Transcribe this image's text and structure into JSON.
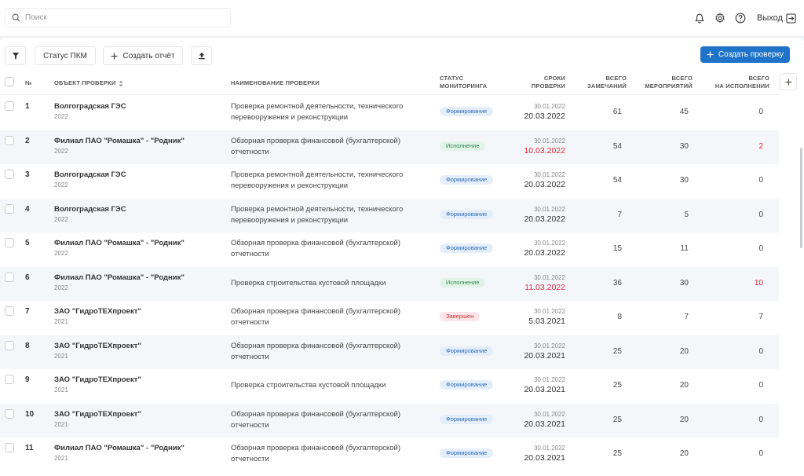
{
  "search": {
    "placeholder": "Поиск",
    "value": ""
  },
  "header": {
    "logout_label": "Выход"
  },
  "icons": {
    "search": "search-icon",
    "bell": "bell-icon",
    "settings": "gear-icon",
    "help": "help-icon",
    "logout": "logout-icon",
    "filter": "filter-icon",
    "upload": "upload-icon",
    "plus": "plus-icon",
    "sort": "sort-icon"
  },
  "colors": {
    "primary": "#1f73c9",
    "red": "#e0283a",
    "badge_form_bg": "#e4eefb",
    "badge_isp_bg": "#e2f4e8",
    "badge_zav_bg": "#fbe5e8"
  },
  "toolbar": {
    "status_pkm_label": "Статус ПКМ",
    "create_report_label": "Создать отчёт",
    "create_check_label": "Создать проверку"
  },
  "table": {
    "columns": {
      "num": "№",
      "object": "ОБЪЕКТ ПРОВЕРКИ",
      "name": "НАИМЕНОВАНИЕ ПРОВЕРКИ",
      "status_l1": "СТАТУС",
      "status_l2": "МОНИТОРИНГА",
      "dates_l1": "СРОКИ",
      "dates_l2": "ПРОВЕРКИ",
      "remarks_l1": "ВСЕГО",
      "remarks_l2": "ЗАМЕЧАНИЙ",
      "measures_l1": "ВСЕГО",
      "measures_l2": "МЕРОПРИЯТИЙ",
      "exec_l1": "ВСЕГО",
      "exec_l2": "НА ИСПОЛНЕНИИ"
    },
    "rows": [
      {
        "num": "1",
        "object": "Волгоградская ГЭС",
        "year": "2022",
        "name": "Проверка ремонтной деятельности, технического перевооружения и реконструкции",
        "status": "Формирование",
        "status_type": "form",
        "date_start": "30.01.2022",
        "date_end": "20.03.2022",
        "date_end_red": false,
        "remarks": "61",
        "measures": "45",
        "exec": "0",
        "exec_red": false
      },
      {
        "num": "2",
        "object": "Филиал ПАО \"Ромашка\" - \"Родник\"",
        "year": "2022",
        "name": "Обзорная проверка финансовой (бухгалтерской) отчетности",
        "status": "Исполнение",
        "status_type": "isp",
        "date_start": "30.01.2022",
        "date_end": "10.03.2022",
        "date_end_red": true,
        "remarks": "54",
        "measures": "30",
        "exec": "2",
        "exec_red": true
      },
      {
        "num": "3",
        "object": "Волгоградская ГЭС",
        "year": "2022",
        "name": "Проверка ремонтной деятельности, технического перевооружения и реконструкции",
        "status": "Формирование",
        "status_type": "form",
        "date_start": "30.01.2022",
        "date_end": "20.03.2022",
        "date_end_red": false,
        "remarks": "54",
        "measures": "30",
        "exec": "0",
        "exec_red": false
      },
      {
        "num": "4",
        "object": "Волгоградская ГЭС",
        "year": "2022",
        "name": "Проверка ремонтной деятельности, технического перевооружения и реконструкции",
        "status": "Формирование",
        "status_type": "form",
        "date_start": "30.01.2022",
        "date_end": "20.03.2022",
        "date_end_red": false,
        "remarks": "7",
        "measures": "5",
        "exec": "0",
        "exec_red": false
      },
      {
        "num": "5",
        "object": "Филиал ПАО \"Ромашка\" - \"Родник\"",
        "year": "2022",
        "name": "Обзорная проверка финансовой (бухгалтерской) отчетности",
        "status": "Формирование",
        "status_type": "form",
        "date_start": "30.01.2022",
        "date_end": "20.03.2022",
        "date_end_red": false,
        "remarks": "15",
        "measures": "11",
        "exec": "0",
        "exec_red": false
      },
      {
        "num": "6",
        "object": "Филиал ПАО \"Ромашка\" - \"Родник\"",
        "year": "2022",
        "name": "Проверка строительства кустовой площадки",
        "status": "Исполнение",
        "status_type": "isp",
        "date_start": "30.01.2022",
        "date_end": "11.03.2022",
        "date_end_red": true,
        "remarks": "36",
        "measures": "30",
        "exec": "10",
        "exec_red": true
      },
      {
        "num": "7",
        "object": "ЗАО \"ГидроТЕХпроект\"",
        "year": "2021",
        "name": "Обзорная проверка финансовой (бухгалтерской) отчетности",
        "status": "Завершен",
        "status_type": "zav",
        "date_start": "30.01.2022",
        "date_end": "5.03.2021",
        "date_end_red": false,
        "remarks": "8",
        "measures": "7",
        "exec": "7",
        "exec_red": false
      },
      {
        "num": "8",
        "object": "ЗАО \"ГидроТЕХпроект\"",
        "year": "2021",
        "name": "Обзорная проверка финансовой (бухгалтерской) отчетности",
        "status": "Формирование",
        "status_type": "form",
        "date_start": "30.01.2022",
        "date_end": "20.03.2021",
        "date_end_red": false,
        "remarks": "25",
        "measures": "20",
        "exec": "0",
        "exec_red": false
      },
      {
        "num": "9",
        "object": "ЗАО \"ГидроТЕХпроект\"",
        "year": "2021",
        "name": "Проверка строительства кустовой площадки",
        "status": "Формирование",
        "status_type": "form",
        "date_start": "30.01.2022",
        "date_end": "20.03.2021",
        "date_end_red": false,
        "remarks": "25",
        "measures": "20",
        "exec": "0",
        "exec_red": false
      },
      {
        "num": "10",
        "object": "ЗАО \"ГидроТЕХпроект\"",
        "year": "2021",
        "name": "Обзорная проверка финансовой (бухгалтерской) отчетности",
        "status": "Формирование",
        "status_type": "form",
        "date_start": "30.01.2022",
        "date_end": "20.03.2021",
        "date_end_red": false,
        "remarks": "25",
        "measures": "20",
        "exec": "0",
        "exec_red": false
      },
      {
        "num": "11",
        "object": "Филиал ПАО \"Ромашка\" - \"Родник\"",
        "year": "2021",
        "name": "Обзорная проверка финансовой (бухгалтерской) отчетности",
        "status": "Формирование",
        "status_type": "form",
        "date_start": "30.01.2022",
        "date_end": "20.03.2021",
        "date_end_red": false,
        "remarks": "25",
        "measures": "20",
        "exec": "0",
        "exec_red": false
      }
    ]
  }
}
